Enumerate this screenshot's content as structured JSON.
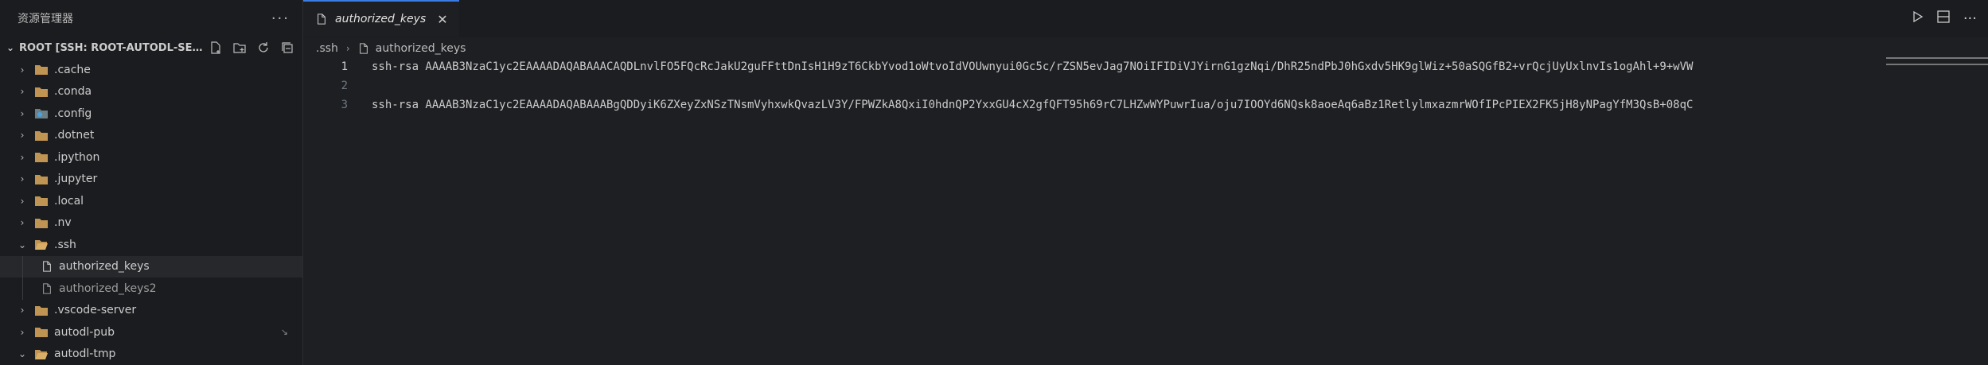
{
  "sidebar": {
    "title": "资源管理器",
    "more": "···",
    "root_label": "ROOT [SSH: ROOT-AUTODL-SERV...",
    "items": [
      {
        "label": ".cache",
        "icon": "folder-icon",
        "expanded": false
      },
      {
        "label": ".conda",
        "icon": "folder-icon",
        "expanded": false
      },
      {
        "label": ".config",
        "icon": "folder-config-icon",
        "expanded": false
      },
      {
        "label": ".dotnet",
        "icon": "folder-icon",
        "expanded": false
      },
      {
        "label": ".ipython",
        "icon": "folder-icon",
        "expanded": false
      },
      {
        "label": ".jupyter",
        "icon": "folder-icon",
        "expanded": false
      },
      {
        "label": ".local",
        "icon": "folder-icon",
        "expanded": false
      },
      {
        "label": ".nv",
        "icon": "folder-icon",
        "expanded": false
      },
      {
        "label": ".ssh",
        "icon": "folder-open-icon",
        "expanded": true
      },
      {
        "label": "authorized_keys",
        "icon": "file-icon",
        "selected": true
      },
      {
        "label": "authorized_keys2",
        "icon": "file-icon"
      },
      {
        "label": ".vscode-server",
        "icon": "folder-icon",
        "expanded": false
      },
      {
        "label": "autodl-pub",
        "icon": "folder-icon",
        "expanded": false
      },
      {
        "label": "autodl-tmp",
        "icon": "folder-open-icon",
        "expanded": true
      }
    ]
  },
  "editor": {
    "tab_label": "authorized_keys",
    "breadcrumb": [
      ".ssh",
      "authorized_keys"
    ],
    "lines": [
      {
        "number": "1",
        "text": "ssh-rsa AAAAB3NzaC1yc2EAAAADAQABAAACAQDLnvlFO5FQcRcJakU2guFFttDnIsH1H9zT6CkbYvod1oWtvoIdVOUwnyui0Gc5c/rZSN5evJag7NOiIFIDiVJYirnG1gzNqi/DhR25ndPbJ0hGxdv5HK9glWiz+50aSQGfB2+vrQcjUyUxlnvIs1ogAhl+9+wVW"
      },
      {
        "number": "2",
        "text": ""
      },
      {
        "number": "3",
        "text": "ssh-rsa AAAAB3NzaC1yc2EAAAADAQABAAABgQDDyiK6ZXeyZxNSzTNsmVyhxwkQvazLV3Y/FPWZkA8QxiI0hdnQP2YxxGU4cX2gfQFT95h69rC7LHZwWYPuwrIua/oju7IOOYd6NQsk8aoeAq6aBz1RetlylmxazmrWOfIPcPIEX2FK5jH8yNPagYfM3QsB+08qC"
      }
    ]
  },
  "colors": {
    "accent": "#3c7ce0",
    "folder": "#c09553",
    "background": "#1e1f22"
  }
}
